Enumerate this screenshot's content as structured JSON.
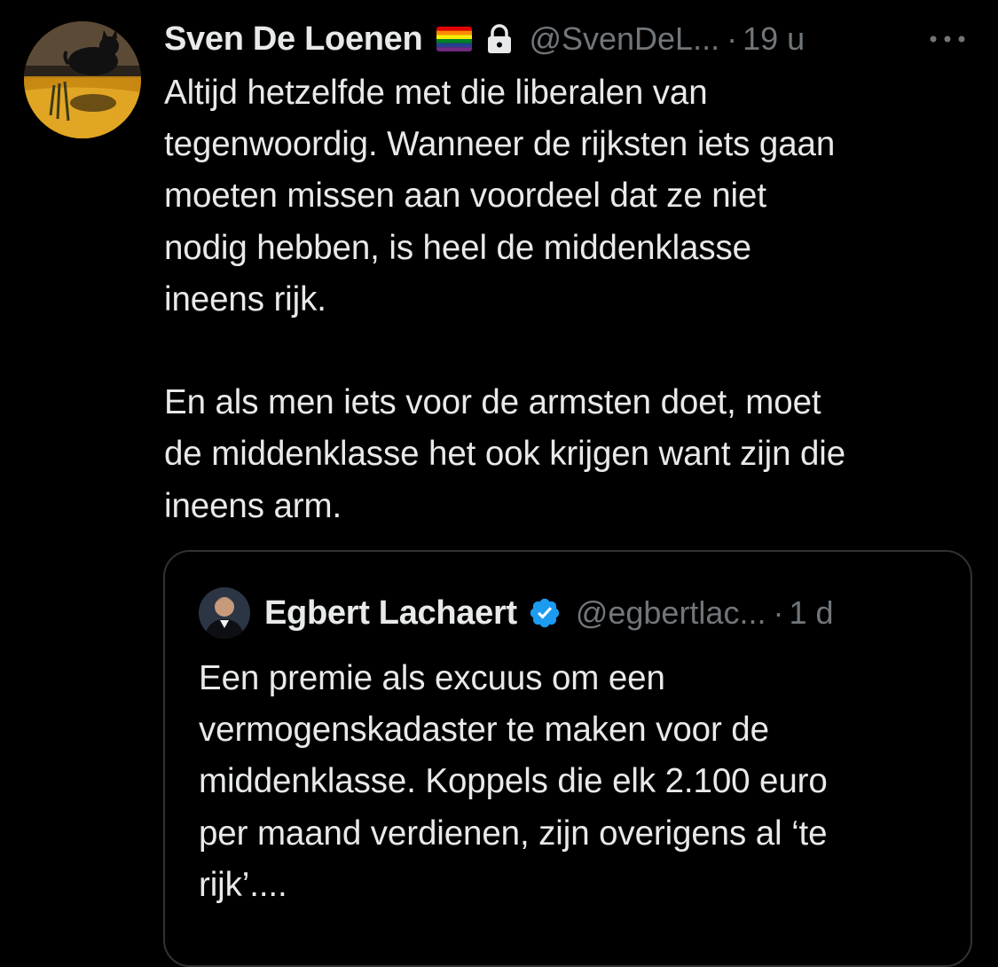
{
  "tweet": {
    "author": {
      "name": "Sven De Loenen",
      "badge_icon": "rainbow-flag-icon",
      "protected_icon": "lock-icon",
      "handle": "@SvenDeL...",
      "separator": "·",
      "time": "19 u"
    },
    "more_icon": "more-options-icon",
    "text": "Altijd hetzelfde met die liberalen van\ntegenwoordig. Wanneer de rijksten iets gaan\nmoeten missen aan voordeel dat ze niet\nnodig hebben, is heel de middenklasse\nineens rijk.\n\nEn als men iets voor de armsten doet, moet\nde middenklasse het ook krijgen want zijn die\nineens arm."
  },
  "quote": {
    "author": {
      "name": "Egbert Lachaert",
      "verified_icon": "verified-badge-icon",
      "handle": "@egbertlac...",
      "separator": "·",
      "time": "1 d"
    },
    "text": "Een premie als excuus om een\nvermogenskadaster te maken voor de\nmiddenklasse. Koppels die elk 2.100 euro\nper maand verdienen, zijn overigens al ‘te\nrijk’...."
  },
  "colors": {
    "background": "#000000",
    "primary_text": "#e7e9ea",
    "secondary_text": "#71767b",
    "border": "#2f3336",
    "verified_blue": "#1d9bf0"
  }
}
